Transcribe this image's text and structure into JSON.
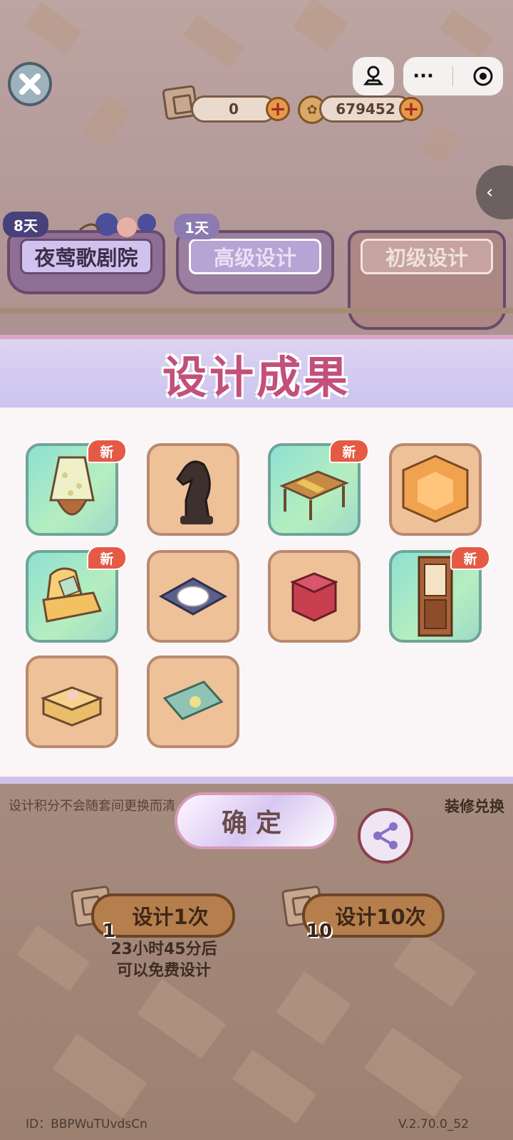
{
  "hud": {
    "tickets_value": "0",
    "coins_value": "679452",
    "plus_symbol": "+",
    "close_icon": "close-icon",
    "menu_dots": "···"
  },
  "tabs": [
    {
      "label": "夜莺歌剧院",
      "days": "8天"
    },
    {
      "label": "高级设计",
      "days": "1天"
    },
    {
      "label": "初级设计"
    }
  ],
  "panel": {
    "title": "设计成果",
    "new_label": "新",
    "items": [
      {
        "name": "floral-lamp",
        "new": true
      },
      {
        "name": "chess-knight",
        "new": false
      },
      {
        "name": "wooden-table",
        "new": true
      },
      {
        "name": "corner-cabinet",
        "new": false
      },
      {
        "name": "armchair",
        "new": true
      },
      {
        "name": "plate-placemat",
        "new": false
      },
      {
        "name": "red-stool",
        "new": false
      },
      {
        "name": "glass-cabinet",
        "new": true
      },
      {
        "name": "tissue-box",
        "new": false
      },
      {
        "name": "cushion-roll",
        "new": false
      }
    ]
  },
  "bottom": {
    "hint": "设计积分不会随套间更换而清",
    "redeem_label": "装修兑换",
    "confirm_label": "确定",
    "design_once_label": "设计1次",
    "design_ten_label": "设计10次",
    "cost_once": "1",
    "cost_ten": "10",
    "free_line1": "23小时45分后",
    "free_line2": "可以免费设计"
  },
  "footer": {
    "id_text": "ID：BBPWuTUvdsCn",
    "version": "V.2.70.0_52"
  }
}
